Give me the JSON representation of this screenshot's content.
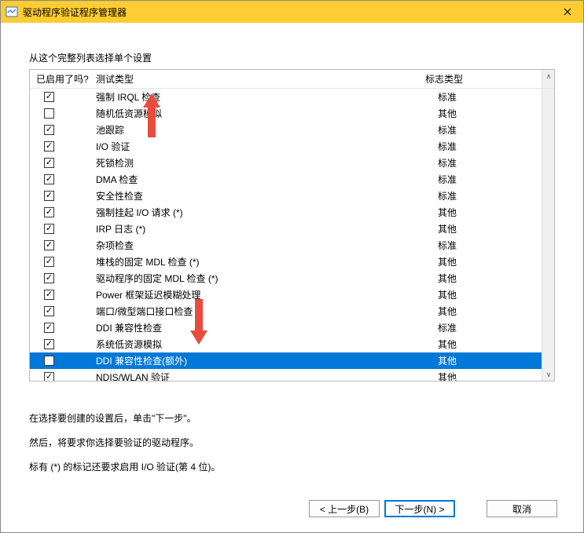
{
  "window": {
    "title": "驱动程序验证程序管理器"
  },
  "subtitle": "从这个完整列表选择单个设置",
  "columns": {
    "enabled": "已启用了吗?",
    "test_type": "测试类型",
    "flag_type": "标志类型"
  },
  "rows": [
    {
      "checked": true,
      "test": "强制 IRQL 检查",
      "flag": "标准"
    },
    {
      "checked": false,
      "test": "随机低资源模拟",
      "flag": "其他"
    },
    {
      "checked": true,
      "test": "池跟踪",
      "flag": "标准"
    },
    {
      "checked": true,
      "test": "I/O 验证",
      "flag": "标准"
    },
    {
      "checked": true,
      "test": "死锁检测",
      "flag": "标准"
    },
    {
      "checked": true,
      "test": "DMA 检查",
      "flag": "标准"
    },
    {
      "checked": true,
      "test": "安全性检查",
      "flag": "标准"
    },
    {
      "checked": true,
      "test": "强制挂起 I/O 请求 (*)",
      "flag": "其他"
    },
    {
      "checked": true,
      "test": "IRP 日志 (*)",
      "flag": "其他"
    },
    {
      "checked": true,
      "test": "杂项检查",
      "flag": "标准"
    },
    {
      "checked": true,
      "test": "堆栈的固定 MDL 检查 (*)",
      "flag": "其他"
    },
    {
      "checked": true,
      "test": "驱动程序的固定 MDL 检查 (*)",
      "flag": "其他"
    },
    {
      "checked": true,
      "test": "Power 框架延迟模糊处理",
      "flag": "其他"
    },
    {
      "checked": true,
      "test": "端口/微型端口接口检查",
      "flag": "其他"
    },
    {
      "checked": true,
      "test": "DDI 兼容性检查",
      "flag": "标准"
    },
    {
      "checked": true,
      "test": "系统低资源模拟",
      "flag": "其他"
    },
    {
      "checked": false,
      "test": "DDI 兼容性检查(额外)",
      "flag": "其他",
      "selected": true
    },
    {
      "checked": true,
      "test": "NDIS/WLAN 验证",
      "flag": "其他"
    }
  ],
  "notes": {
    "line1": "在选择要创建的设置后，单击\"下一步\"。",
    "line2": "然后，将要求你选择要验证的驱动程序。",
    "line3": "标有 (*) 的标记还要求启用 I/O 验证(第 4 位)。"
  },
  "buttons": {
    "back": "< 上一步(B)",
    "next": "下一步(N) >",
    "cancel": "取消"
  }
}
